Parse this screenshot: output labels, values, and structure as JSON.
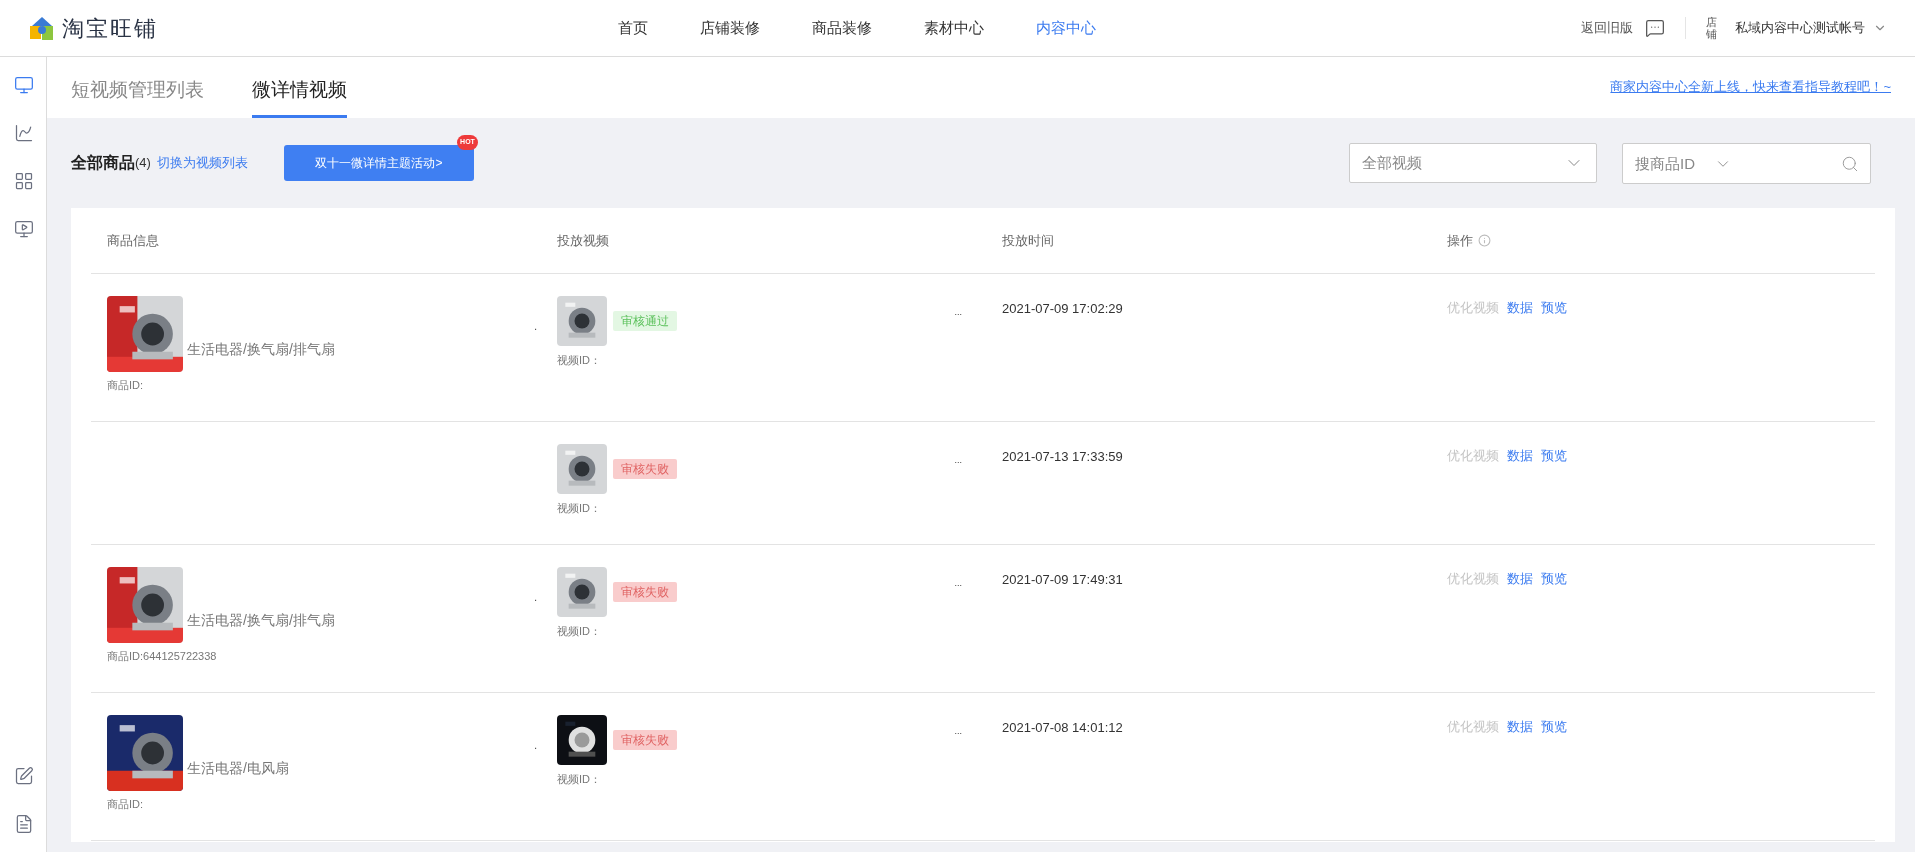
{
  "header": {
    "logo": "淘宝旺铺",
    "nav": [
      {
        "label": "首页",
        "selected": false
      },
      {
        "label": "店铺装修",
        "selected": false
      },
      {
        "label": "商品装修",
        "selected": false
      },
      {
        "label": "素材中心",
        "selected": false
      },
      {
        "label": "内容中心",
        "selected": true
      }
    ],
    "back_link": "返回旧版",
    "avatar_alt": "店铺",
    "account": "私域内容中心测试帐号"
  },
  "sidebar": {
    "items": [
      {
        "selected": true
      },
      {
        "selected": false
      },
      {
        "selected": false
      },
      {
        "selected": false
      }
    ],
    "bottom_items": [
      {
        "selected": false
      },
      {
        "selected": false
      }
    ]
  },
  "tabs": [
    {
      "label": "短视频管理列表",
      "selected": false
    },
    {
      "label": "微详情视频",
      "selected": true
    }
  ],
  "guide_link": "商家内容中心全新上线，快来查看指导教程吧！~",
  "toolbar": {
    "title": "全部商品",
    "count": "(4)",
    "switch_link": "切换为视频列表",
    "promo_button": "双十一微详情主题活动>",
    "promo_badge": "HOT",
    "filter": {
      "value": "全部视频"
    },
    "search": {
      "placeholder": "搜商品ID"
    }
  },
  "table": {
    "columns": [
      "商品信息",
      "投放视频",
      "投放时间",
      "操作"
    ],
    "rows": [
      {
        "product": {
          "category": "生活电器/换气扇/排气扇",
          "id_label": "商品ID:"
        },
        "dot": ".",
        "video": {
          "status": "审核通过",
          "kind": "pass",
          "id_label": "视频ID："
        },
        "ellipsis": "...",
        "time": "2021-07-09 17:02:29",
        "actions": [
          {
            "label": "优化视频",
            "disabled": true
          },
          {
            "label": "数据",
            "disabled": false
          },
          {
            "label": "预览",
            "disabled": false
          }
        ]
      },
      {
        "video": {
          "status": "审核失败",
          "kind": "fail",
          "id_label": "视频ID："
        },
        "ellipsis": "...",
        "time": "2021-07-13 17:33:59",
        "actions": [
          {
            "label": "优化视频",
            "disabled": true
          },
          {
            "label": "数据",
            "disabled": false
          },
          {
            "label": "预览",
            "disabled": false
          }
        ]
      },
      {
        "product": {
          "category": "生活电器/换气扇/排气扇",
          "id_label": "商品ID:644125722338"
        },
        "dot": ".",
        "video": {
          "status": "审核失败",
          "kind": "fail",
          "id_label": "视频ID："
        },
        "ellipsis": "...",
        "time": "2021-07-09 17:49:31",
        "actions": [
          {
            "label": "优化视频",
            "disabled": true
          },
          {
            "label": "数据",
            "disabled": false
          },
          {
            "label": "预览",
            "disabled": false
          }
        ]
      },
      {
        "product": {
          "category": "生活电器/电风扇",
          "id_label": "商品ID:"
        },
        "dot": ".",
        "video": {
          "status": "审核失败",
          "kind": "fail",
          "id_label": "视频ID："
        },
        "ellipsis": "...",
        "time": "2021-07-08 14:01:12",
        "actions": [
          {
            "label": "优化视频",
            "disabled": true
          },
          {
            "label": "数据",
            "disabled": false
          },
          {
            "label": "预览",
            "disabled": false
          }
        ]
      }
    ]
  }
}
